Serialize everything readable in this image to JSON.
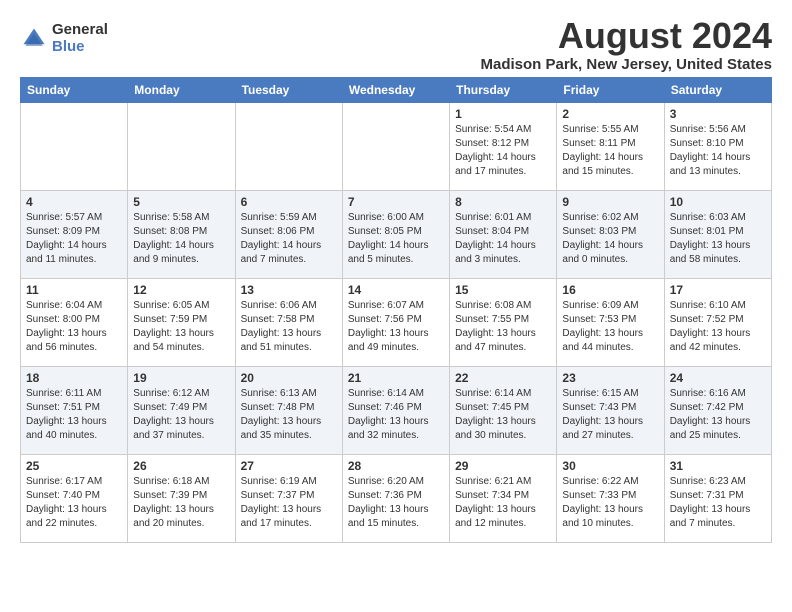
{
  "logo": {
    "general": "General",
    "blue": "Blue"
  },
  "title": "August 2024",
  "subtitle": "Madison Park, New Jersey, United States",
  "days_header": [
    "Sunday",
    "Monday",
    "Tuesday",
    "Wednesday",
    "Thursday",
    "Friday",
    "Saturday"
  ],
  "weeks": [
    [
      {
        "day": "",
        "sunrise": "",
        "sunset": "",
        "daylight": ""
      },
      {
        "day": "",
        "sunrise": "",
        "sunset": "",
        "daylight": ""
      },
      {
        "day": "",
        "sunrise": "",
        "sunset": "",
        "daylight": ""
      },
      {
        "day": "",
        "sunrise": "",
        "sunset": "",
        "daylight": ""
      },
      {
        "day": "1",
        "sunrise": "Sunrise: 5:54 AM",
        "sunset": "Sunset: 8:12 PM",
        "daylight": "Daylight: 14 hours and 17 minutes."
      },
      {
        "day": "2",
        "sunrise": "Sunrise: 5:55 AM",
        "sunset": "Sunset: 8:11 PM",
        "daylight": "Daylight: 14 hours and 15 minutes."
      },
      {
        "day": "3",
        "sunrise": "Sunrise: 5:56 AM",
        "sunset": "Sunset: 8:10 PM",
        "daylight": "Daylight: 14 hours and 13 minutes."
      }
    ],
    [
      {
        "day": "4",
        "sunrise": "Sunrise: 5:57 AM",
        "sunset": "Sunset: 8:09 PM",
        "daylight": "Daylight: 14 hours and 11 minutes."
      },
      {
        "day": "5",
        "sunrise": "Sunrise: 5:58 AM",
        "sunset": "Sunset: 8:08 PM",
        "daylight": "Daylight: 14 hours and 9 minutes."
      },
      {
        "day": "6",
        "sunrise": "Sunrise: 5:59 AM",
        "sunset": "Sunset: 8:06 PM",
        "daylight": "Daylight: 14 hours and 7 minutes."
      },
      {
        "day": "7",
        "sunrise": "Sunrise: 6:00 AM",
        "sunset": "Sunset: 8:05 PM",
        "daylight": "Daylight: 14 hours and 5 minutes."
      },
      {
        "day": "8",
        "sunrise": "Sunrise: 6:01 AM",
        "sunset": "Sunset: 8:04 PM",
        "daylight": "Daylight: 14 hours and 3 minutes."
      },
      {
        "day": "9",
        "sunrise": "Sunrise: 6:02 AM",
        "sunset": "Sunset: 8:03 PM",
        "daylight": "Daylight: 14 hours and 0 minutes."
      },
      {
        "day": "10",
        "sunrise": "Sunrise: 6:03 AM",
        "sunset": "Sunset: 8:01 PM",
        "daylight": "Daylight: 13 hours and 58 minutes."
      }
    ],
    [
      {
        "day": "11",
        "sunrise": "Sunrise: 6:04 AM",
        "sunset": "Sunset: 8:00 PM",
        "daylight": "Daylight: 13 hours and 56 minutes."
      },
      {
        "day": "12",
        "sunrise": "Sunrise: 6:05 AM",
        "sunset": "Sunset: 7:59 PM",
        "daylight": "Daylight: 13 hours and 54 minutes."
      },
      {
        "day": "13",
        "sunrise": "Sunrise: 6:06 AM",
        "sunset": "Sunset: 7:58 PM",
        "daylight": "Daylight: 13 hours and 51 minutes."
      },
      {
        "day": "14",
        "sunrise": "Sunrise: 6:07 AM",
        "sunset": "Sunset: 7:56 PM",
        "daylight": "Daylight: 13 hours and 49 minutes."
      },
      {
        "day": "15",
        "sunrise": "Sunrise: 6:08 AM",
        "sunset": "Sunset: 7:55 PM",
        "daylight": "Daylight: 13 hours and 47 minutes."
      },
      {
        "day": "16",
        "sunrise": "Sunrise: 6:09 AM",
        "sunset": "Sunset: 7:53 PM",
        "daylight": "Daylight: 13 hours and 44 minutes."
      },
      {
        "day": "17",
        "sunrise": "Sunrise: 6:10 AM",
        "sunset": "Sunset: 7:52 PM",
        "daylight": "Daylight: 13 hours and 42 minutes."
      }
    ],
    [
      {
        "day": "18",
        "sunrise": "Sunrise: 6:11 AM",
        "sunset": "Sunset: 7:51 PM",
        "daylight": "Daylight: 13 hours and 40 minutes."
      },
      {
        "day": "19",
        "sunrise": "Sunrise: 6:12 AM",
        "sunset": "Sunset: 7:49 PM",
        "daylight": "Daylight: 13 hours and 37 minutes."
      },
      {
        "day": "20",
        "sunrise": "Sunrise: 6:13 AM",
        "sunset": "Sunset: 7:48 PM",
        "daylight": "Daylight: 13 hours and 35 minutes."
      },
      {
        "day": "21",
        "sunrise": "Sunrise: 6:14 AM",
        "sunset": "Sunset: 7:46 PM",
        "daylight": "Daylight: 13 hours and 32 minutes."
      },
      {
        "day": "22",
        "sunrise": "Sunrise: 6:14 AM",
        "sunset": "Sunset: 7:45 PM",
        "daylight": "Daylight: 13 hours and 30 minutes."
      },
      {
        "day": "23",
        "sunrise": "Sunrise: 6:15 AM",
        "sunset": "Sunset: 7:43 PM",
        "daylight": "Daylight: 13 hours and 27 minutes."
      },
      {
        "day": "24",
        "sunrise": "Sunrise: 6:16 AM",
        "sunset": "Sunset: 7:42 PM",
        "daylight": "Daylight: 13 hours and 25 minutes."
      }
    ],
    [
      {
        "day": "25",
        "sunrise": "Sunrise: 6:17 AM",
        "sunset": "Sunset: 7:40 PM",
        "daylight": "Daylight: 13 hours and 22 minutes."
      },
      {
        "day": "26",
        "sunrise": "Sunrise: 6:18 AM",
        "sunset": "Sunset: 7:39 PM",
        "daylight": "Daylight: 13 hours and 20 minutes."
      },
      {
        "day": "27",
        "sunrise": "Sunrise: 6:19 AM",
        "sunset": "Sunset: 7:37 PM",
        "daylight": "Daylight: 13 hours and 17 minutes."
      },
      {
        "day": "28",
        "sunrise": "Sunrise: 6:20 AM",
        "sunset": "Sunset: 7:36 PM",
        "daylight": "Daylight: 13 hours and 15 minutes."
      },
      {
        "day": "29",
        "sunrise": "Sunrise: 6:21 AM",
        "sunset": "Sunset: 7:34 PM",
        "daylight": "Daylight: 13 hours and 12 minutes."
      },
      {
        "day": "30",
        "sunrise": "Sunrise: 6:22 AM",
        "sunset": "Sunset: 7:33 PM",
        "daylight": "Daylight: 13 hours and 10 minutes."
      },
      {
        "day": "31",
        "sunrise": "Sunrise: 6:23 AM",
        "sunset": "Sunset: 7:31 PM",
        "daylight": "Daylight: 13 hours and 7 minutes."
      }
    ]
  ]
}
